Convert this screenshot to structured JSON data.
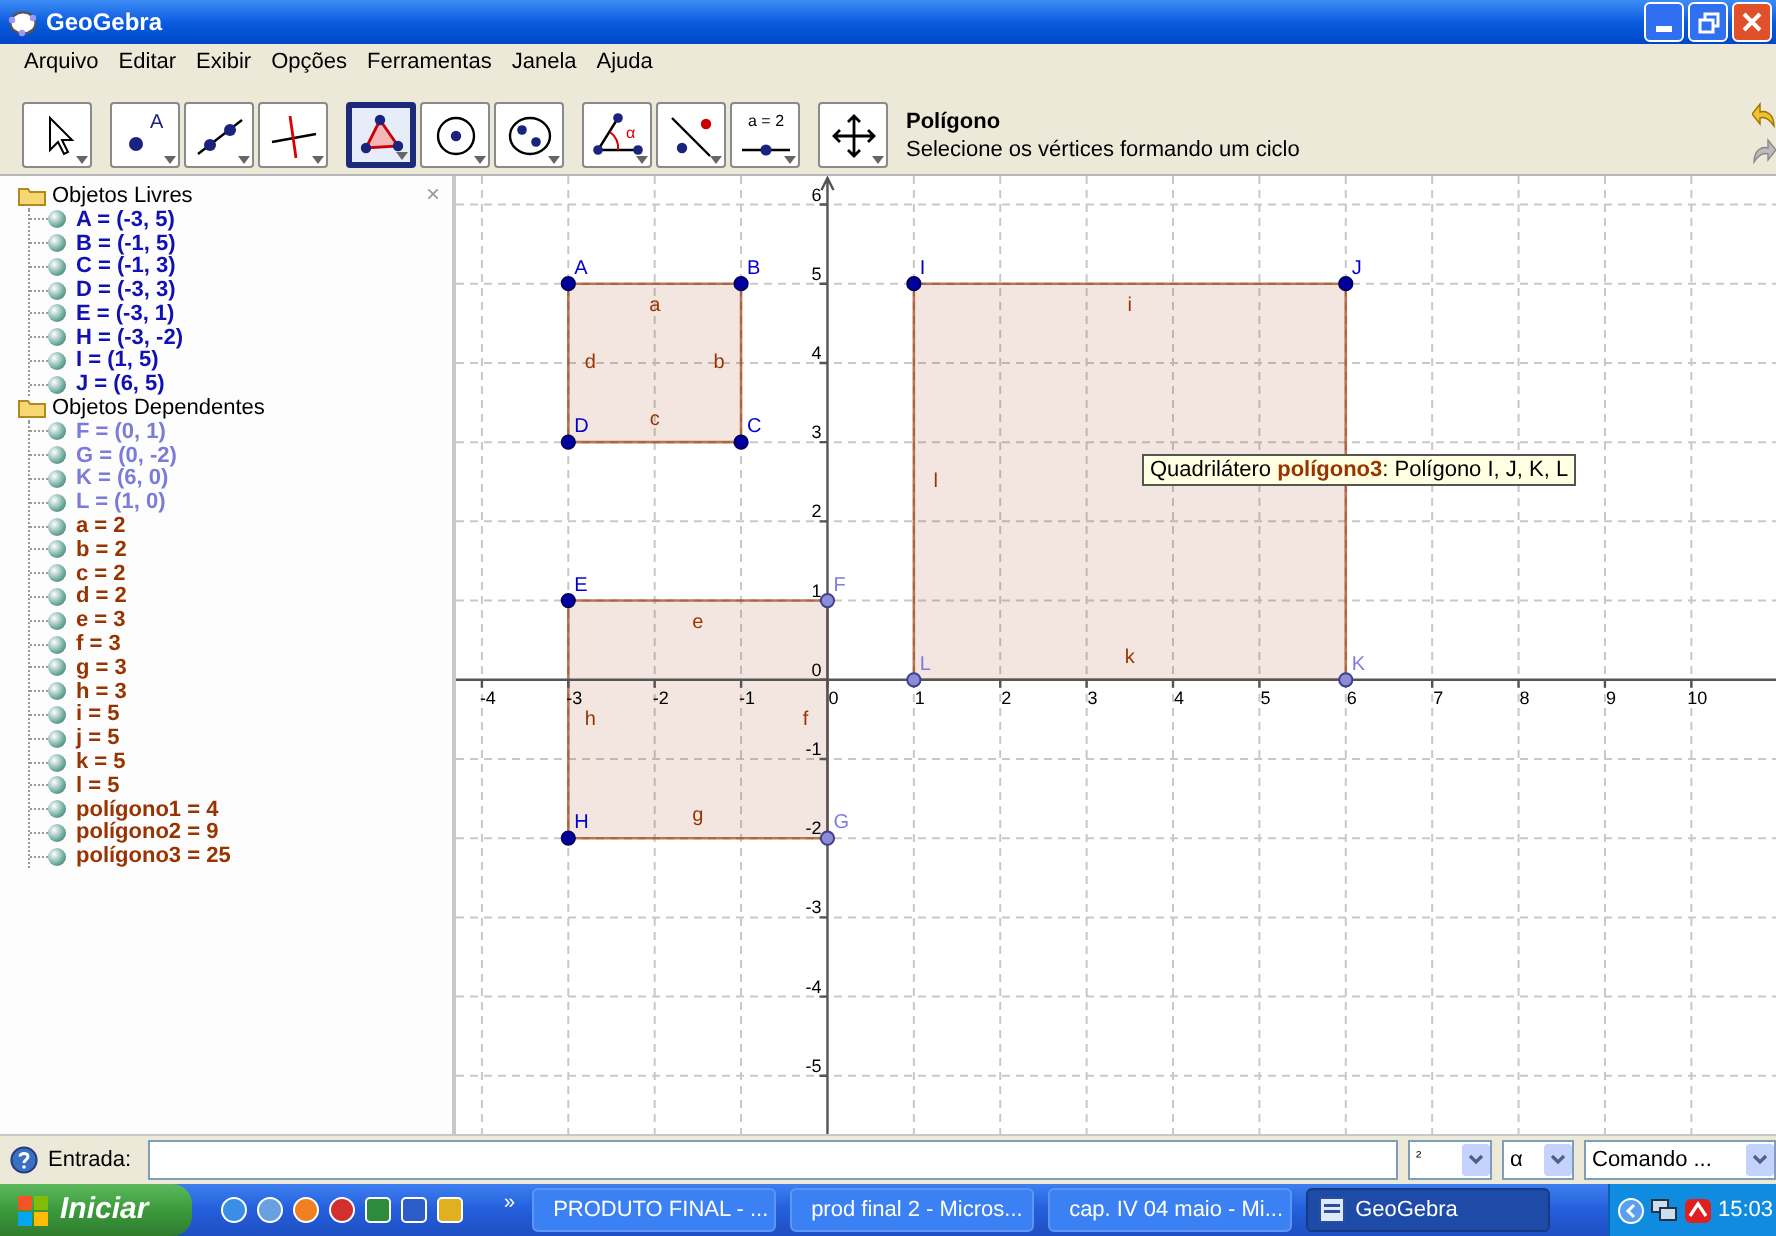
{
  "window": {
    "title": "GeoGebra"
  },
  "menu": [
    "Arquivo",
    "Editar",
    "Exibir",
    "Opções",
    "Ferramentas",
    "Janela",
    "Ajuda"
  ],
  "toolbar": {
    "groups": [
      [
        {
          "kind": "move",
          "selected": false
        }
      ],
      [
        {
          "kind": "point",
          "selected": false,
          "label": "A"
        },
        {
          "kind": "line",
          "selected": false
        },
        {
          "kind": "perpendicular",
          "selected": false
        }
      ],
      [
        {
          "kind": "polygon",
          "selected": true
        },
        {
          "kind": "circle",
          "selected": false
        },
        {
          "kind": "conic",
          "selected": false
        }
      ],
      [
        {
          "kind": "angle",
          "selected": false,
          "label": "α"
        },
        {
          "kind": "reflect",
          "selected": false
        },
        {
          "kind": "slider",
          "selected": false,
          "label": "a = 2"
        }
      ],
      [
        {
          "kind": "move_view",
          "selected": false
        }
      ]
    ],
    "tool_name": "Polígono",
    "tool_help": "Selecione os vértices formando um ciclo"
  },
  "algebra": {
    "close": "×",
    "groups": [
      {
        "title": "Objetos Livres",
        "items": [
          {
            "text": "A = (-3, 5)",
            "color": "#1010b4"
          },
          {
            "text": "B = (-1, 5)",
            "color": "#1010b4"
          },
          {
            "text": "C = (-1, 3)",
            "color": "#1010b4"
          },
          {
            "text": "D = (-3, 3)",
            "color": "#1010b4"
          },
          {
            "text": "E = (-3, 1)",
            "color": "#1010b4"
          },
          {
            "text": "H = (-3, -2)",
            "color": "#1010b4"
          },
          {
            "text": "I = (1, 5)",
            "color": "#1010b4"
          },
          {
            "text": "J = (6, 5)",
            "color": "#1010b4"
          }
        ]
      },
      {
        "title": "Objetos Dependentes",
        "items": [
          {
            "text": "F = (0, 1)",
            "color": "#7c7cd8"
          },
          {
            "text": "G = (0, -2)",
            "color": "#7c7cd8"
          },
          {
            "text": "K = (6, 0)",
            "color": "#7c7cd8"
          },
          {
            "text": "L = (1, 0)",
            "color": "#7c7cd8"
          },
          {
            "text": "a = 2",
            "color": "#993300"
          },
          {
            "text": "b = 2",
            "color": "#993300"
          },
          {
            "text": "c = 2",
            "color": "#993300"
          },
          {
            "text": "d = 2",
            "color": "#993300"
          },
          {
            "text": "e = 3",
            "color": "#993300"
          },
          {
            "text": "f = 3",
            "color": "#993300"
          },
          {
            "text": "g = 3",
            "color": "#993300"
          },
          {
            "text": "h = 3",
            "color": "#993300"
          },
          {
            "text": "i = 5",
            "color": "#993300"
          },
          {
            "text": "j = 5",
            "color": "#993300"
          },
          {
            "text": "k = 5",
            "color": "#993300"
          },
          {
            "text": "l = 5",
            "color": "#993300"
          },
          {
            "text": "polígono1 = 4",
            "color": "#993300"
          },
          {
            "text": "polígono2 = 9",
            "color": "#993300"
          },
          {
            "text": "polígono3 = 25",
            "color": "#993300"
          }
        ]
      }
    ]
  },
  "graphics": {
    "chart_data": {
      "type": "area",
      "grid": true,
      "xlim": [
        -4.3,
        10.98
      ],
      "ylim": [
        -5.76,
        6.36
      ],
      "xticks": [
        -4,
        -3,
        -2,
        -1,
        0,
        1,
        2,
        3,
        4,
        5,
        6,
        7,
        8,
        9,
        10
      ],
      "yticks": [
        -5,
        -4,
        -3,
        -2,
        -1,
        0,
        1,
        2,
        3,
        4,
        5,
        6
      ],
      "series": [
        {
          "color": "#993300",
          "x": [
            -3,
            -1,
            -1,
            -3
          ],
          "values": [
            5,
            5,
            3,
            3
          ]
        },
        {
          "color": "#993300",
          "x": [
            -3,
            0,
            0,
            -3
          ],
          "values": [
            1,
            1,
            -2,
            -2
          ]
        },
        {
          "color": "#993300",
          "x": [
            1,
            6,
            6,
            1
          ],
          "values": [
            5,
            5,
            0,
            0
          ]
        }
      ],
      "value_labels": [
        [
          "A",
          "B",
          "C",
          "D"
        ],
        [
          "E",
          "F",
          "G",
          "H"
        ],
        [
          "I",
          "J",
          "K",
          "L"
        ]
      ],
      "annotations": [
        "a",
        "b",
        "c",
        "d",
        "e",
        "f",
        "g",
        "h",
        "i",
        null,
        "k",
        "l"
      ]
    },
    "vertex_dependent": [
      [
        false,
        false,
        false,
        false
      ],
      [
        false,
        true,
        true,
        false
      ],
      [
        false,
        false,
        true,
        true
      ]
    ],
    "tooltip": "Quadrilátero **polígono3**: Polígono I, J, K, L"
  },
  "input_bar": {
    "label": "Entrada:",
    "combos": [
      "²",
      "α",
      "Comando ..."
    ]
  },
  "taskbar": {
    "start": "Iniciar",
    "overflow": "»",
    "tasks": [
      {
        "label": "PRODUTO FINAL - ...",
        "selected": false
      },
      {
        "label": "prod final 2 - Micros...",
        "selected": false
      },
      {
        "label": "cap. IV 04 maio - Mi...",
        "selected": false
      },
      {
        "label": "GeoGebra",
        "selected": true
      }
    ],
    "clock": "15:03"
  }
}
